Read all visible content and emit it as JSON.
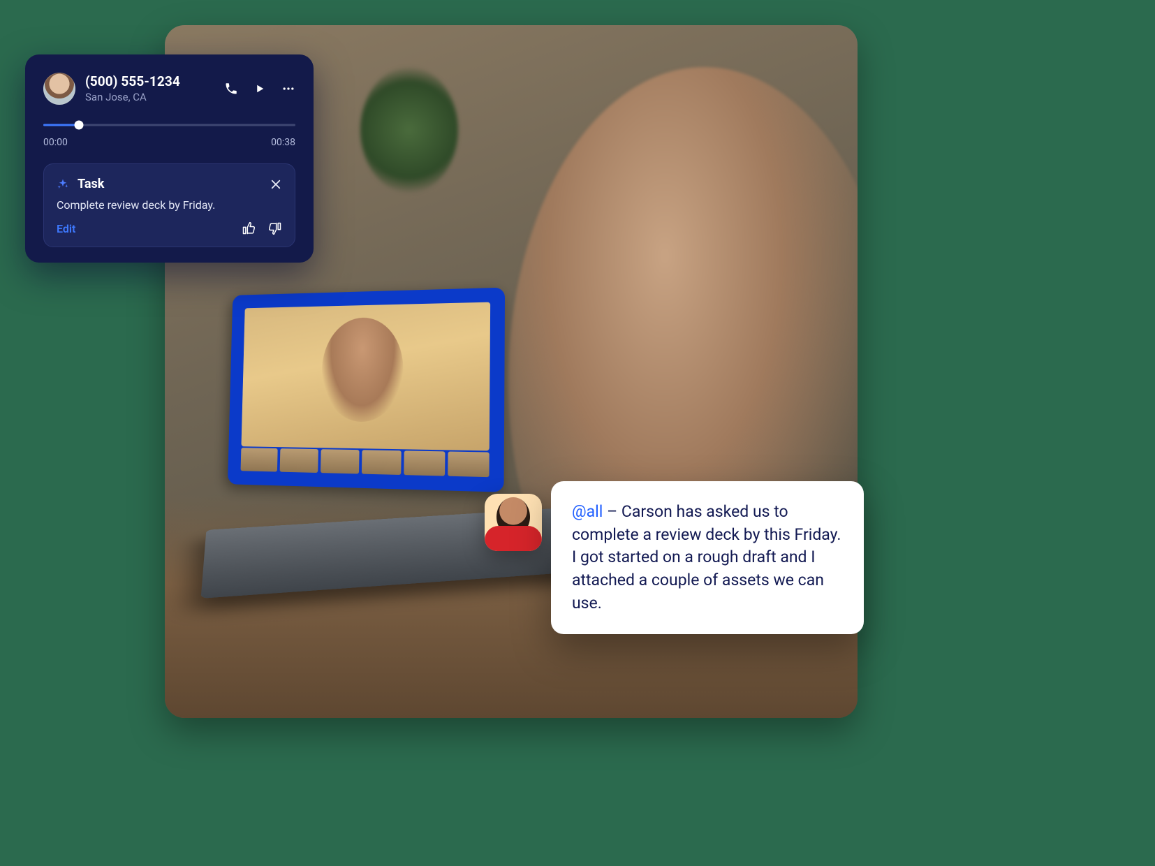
{
  "call": {
    "phone": "(500) 555-1234",
    "location": "San Jose, CA",
    "elapsed": "00:00",
    "duration": "00:38",
    "progress_pct": 14,
    "icons": {
      "call": "call-icon",
      "play": "play-icon",
      "more": "more-icon"
    }
  },
  "task": {
    "label": "Task",
    "description": "Complete review deck by Friday.",
    "edit_label": "Edit",
    "icons": {
      "sparkle": "sparkle-icon",
      "close": "close-icon",
      "thumbs_up": "thumbs-up-icon",
      "thumbs_down": "thumbs-down-icon"
    }
  },
  "message": {
    "mention": "@all",
    "body": " – Carson has asked us to complete a review deck by this Friday. I got started on a rough draft and I attached a couple of assets we can use."
  },
  "colors": {
    "bg": "#2b6a4e",
    "card": "#131a4a",
    "task_card": "#1d265c",
    "accent": "#3e79ff",
    "mention": "#1f5eff",
    "text_dark": "#121952"
  }
}
